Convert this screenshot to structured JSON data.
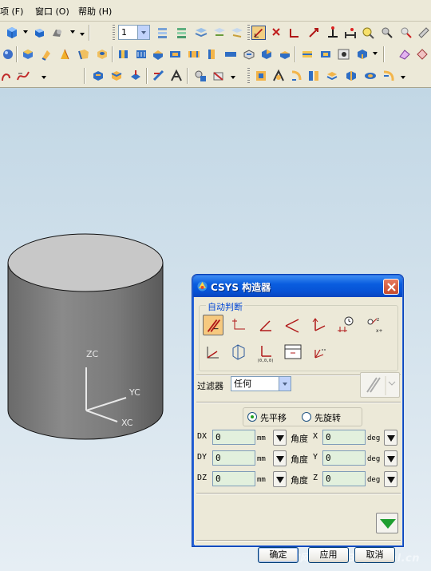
{
  "menu": {
    "items": [
      "项 (F)",
      "窗口 (O)",
      "帮助 (H)"
    ]
  },
  "toolbar": {
    "layer_value": "1"
  },
  "viewport": {
    "axis_labels": {
      "zc": "ZC",
      "yc": "YC",
      "xc": "XC"
    },
    "watermark": "三维网 www.3dportal.cn"
  },
  "dialog": {
    "title": "CSYS 构造器",
    "group_label": "自动判断",
    "filter_label": "过滤器",
    "filter_value": "任何",
    "radio_translate": "先平移",
    "radio_rotate": "先旋转",
    "radio_selected": "translate",
    "rows": [
      {
        "axis": "DX",
        "value": "0",
        "unit": "mm",
        "angle_label": "角度",
        "angle_axis": "X",
        "angle_value": "0",
        "angle_unit": "deg"
      },
      {
        "axis": "DY",
        "value": "0",
        "unit": "mm",
        "angle_label": "角度",
        "angle_axis": "Y",
        "angle_value": "0",
        "angle_unit": "deg"
      },
      {
        "axis": "DZ",
        "value": "0",
        "unit": "mm",
        "angle_label": "角度",
        "angle_axis": "Z",
        "angle_value": "0",
        "angle_unit": "deg"
      }
    ],
    "ok_label": "确定",
    "apply_label": "应用",
    "cancel_label": "取消"
  }
}
